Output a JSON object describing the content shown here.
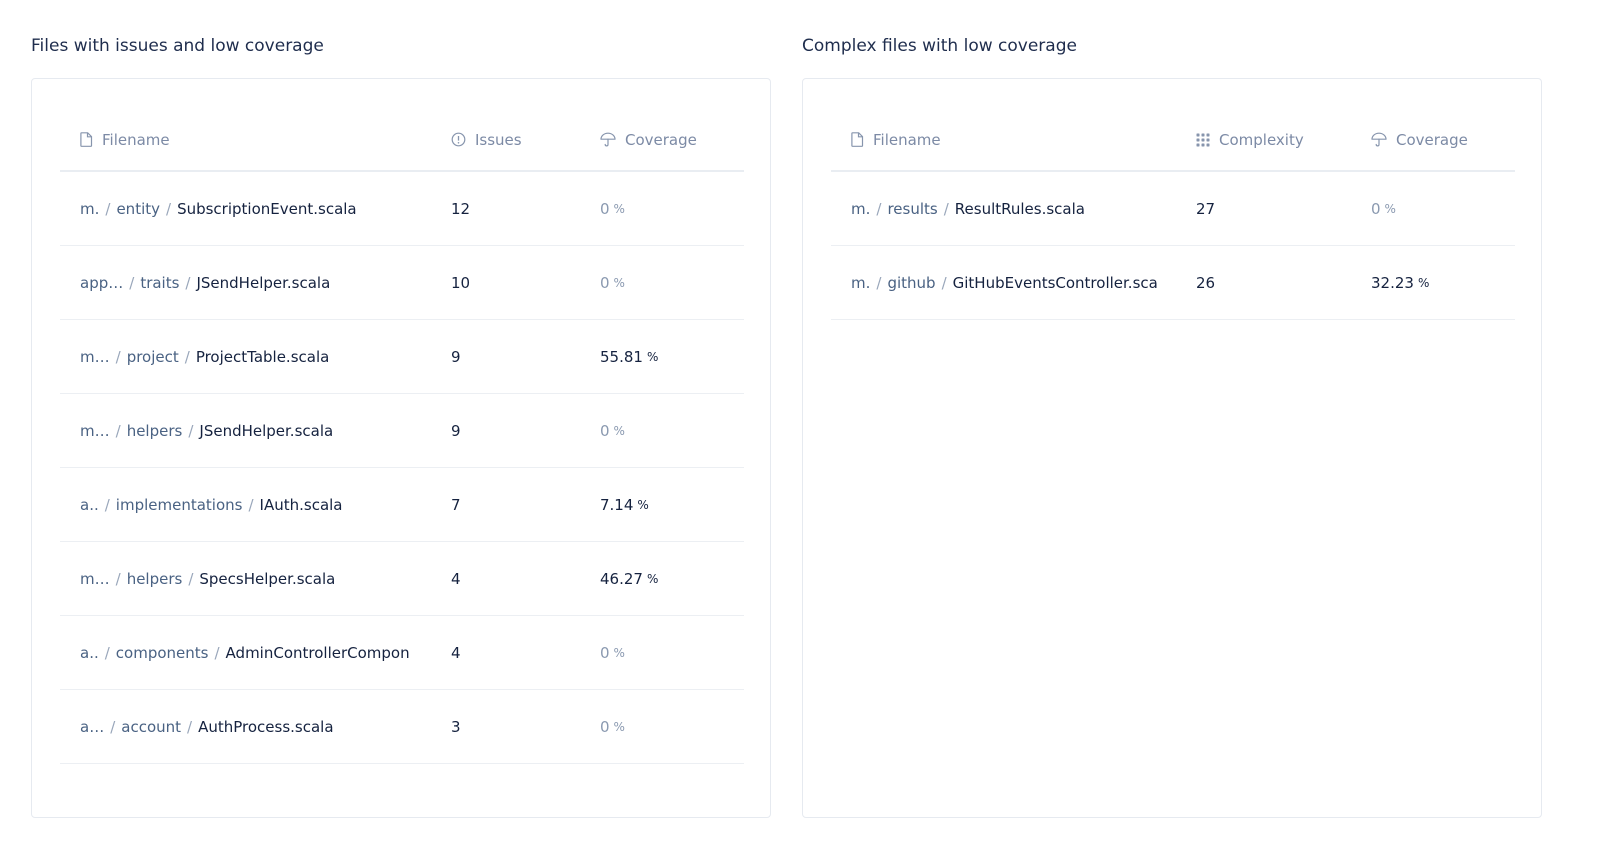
{
  "left_panel": {
    "title": "Files with issues and low coverage",
    "columns": {
      "filename": "Filename",
      "metric": "Issues",
      "coverage": "Coverage"
    },
    "rows": [
      {
        "prefix": "m.",
        "dir": "entity",
        "file": "SubscriptionEvent.scala",
        "value": "12",
        "coverage": "0",
        "unit": "%"
      },
      {
        "prefix": "app…",
        "dir": "traits",
        "file": "JSendHelper.scala",
        "value": "10",
        "coverage": "0",
        "unit": "%"
      },
      {
        "prefix": "m…",
        "dir": "project",
        "file": "ProjectTable.scala",
        "value": "9",
        "coverage": "55.81",
        "unit": "%"
      },
      {
        "prefix": "m…",
        "dir": "helpers",
        "file": "JSendHelper.scala",
        "value": "9",
        "coverage": "0",
        "unit": "%"
      },
      {
        "prefix": "a..",
        "dir": "implementations",
        "file": "IAuth.scala",
        "value": "7",
        "coverage": "7.14",
        "unit": "%"
      },
      {
        "prefix": "m…",
        "dir": "helpers",
        "file": "SpecsHelper.scala",
        "value": "4",
        "coverage": "46.27",
        "unit": "%"
      },
      {
        "prefix": "a..",
        "dir": "components",
        "file": "AdminControllerCompon",
        "value": "4",
        "coverage": "0",
        "unit": "%"
      },
      {
        "prefix": "a…",
        "dir": "account",
        "file": "AuthProcess.scala",
        "value": "3",
        "coverage": "0",
        "unit": "%"
      }
    ]
  },
  "right_panel": {
    "title": "Complex files with low coverage",
    "columns": {
      "filename": "Filename",
      "metric": "Complexity",
      "coverage": "Coverage"
    },
    "rows": [
      {
        "prefix": "m.",
        "dir": "results",
        "file": "ResultRules.scala",
        "value": "27",
        "coverage": "0",
        "unit": "%"
      },
      {
        "prefix": "m.",
        "dir": "github",
        "file": "GitHubEventsController.sca",
        "value": "26",
        "coverage": "32.23",
        "unit": "%"
      }
    ]
  },
  "separator": "/",
  "icons": {
    "filename": "file-icon",
    "issues": "info-circle-icon",
    "complexity": "grid-dots-icon",
    "coverage": "umbrella-icon"
  },
  "colors": {
    "title": "#1f2d4d",
    "header_text": "#7c8aa5",
    "path_text": "#4a6283",
    "primary_text": "#15223f",
    "muted_zero": "#8a99b0",
    "border": "#e6eaf0"
  }
}
